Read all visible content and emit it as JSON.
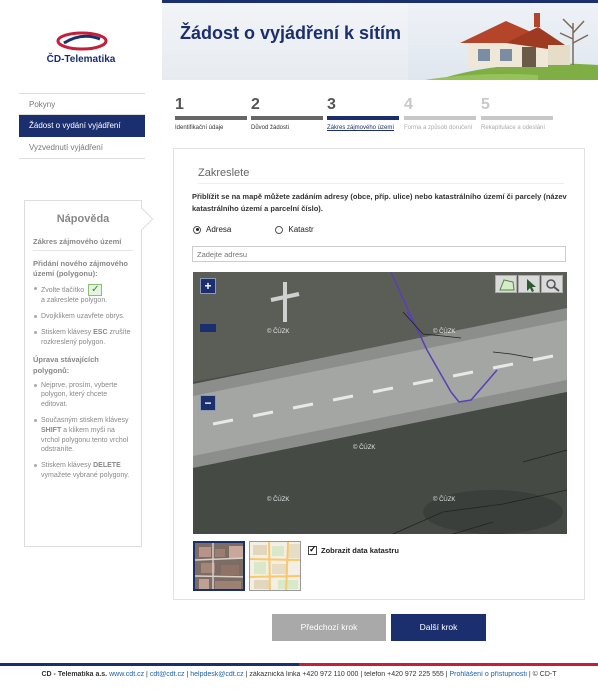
{
  "brand": {
    "name": "ČD-Telematika"
  },
  "header": {
    "title": "Žádost o vyjádření k sítím"
  },
  "sidebar": {
    "items": [
      {
        "label": "Pokyny"
      },
      {
        "label": "Žádost o vydání vyjádření"
      },
      {
        "label": "Vyzvednutí vyjádření"
      }
    ]
  },
  "steps": [
    {
      "num": "1",
      "label": "Identifikační údaje"
    },
    {
      "num": "2",
      "label": "Důvod žádosti"
    },
    {
      "num": "3",
      "label": "Zákres zájmového území"
    },
    {
      "num": "4",
      "label": "Forma a způsob doručení"
    },
    {
      "num": "5",
      "label": "Rekapitulace a odeslání"
    }
  ],
  "help": {
    "title": "Nápověda",
    "subtitle": "Zákres zájmového území",
    "section1_title": "Přidání nového zájmového území (polygonu):",
    "section1_items": {
      "i1a": "Zvolte tlačítko",
      "i1b": "a zakreslete polygon.",
      "i2": "Dvojklikem uzavřete obrys.",
      "i3a": "Stiskem klávesy ",
      "i3key": "ESC",
      "i3b": " zrušíte rozkreslený polygon."
    },
    "section2_title": "Úprava stávajících polygonů:",
    "section2_items": {
      "i1": "Nejprve, prosím, vyberte polygon, který chcete editovat.",
      "i2a": "Současným stiskem klávesy ",
      "i2key": "SHIFT",
      "i2b": " a klikem myši na vrchol polygonu tento vrchol odstraníte.",
      "i3a": "Stiskem klávesy ",
      "i3key": "DELETE",
      "i3b": " vymažete vybrané polygony."
    }
  },
  "form": {
    "title": "Zakreslete",
    "instruction": "Přiblížit se na mapě můžete zadáním adresy (obce, příp. ulice) nebo katastrálního území či parcely (název katastrálního území a parcelní číslo).",
    "radio_address": "Adresa",
    "radio_cadastre": "Katastr",
    "address_placeholder": "Zadejte adresu",
    "zoom_in": "+",
    "zoom_out": "−",
    "watermark": "© ČÚZK",
    "show_cadastre": "Zobrazit data katastru"
  },
  "buttons": {
    "prev": "Předchozí krok",
    "next": "Další krok"
  },
  "footer": {
    "company": "ČD - Telematika a.s.",
    "web": "www.cdt.cz",
    "email1": "cdt@cdt.cz",
    "email2": "helpdesk@cdt.cz",
    "hotline": "zákaznická linka +420 972 110 000",
    "phone": "telefon +420 972 225 555",
    "accessibility": "Prohlášení o přístupnosti",
    "copyright": "© ČD-T"
  },
  "colors": {
    "brand_blue": "#1b2f6e",
    "brand_red": "#c41e3a"
  }
}
